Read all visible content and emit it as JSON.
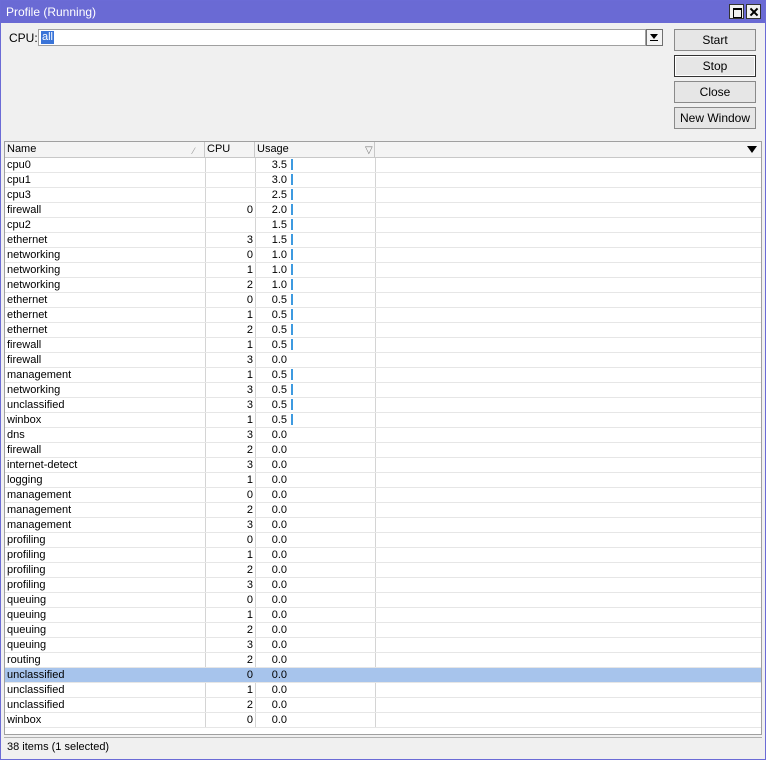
{
  "window": {
    "title": "Profile (Running)"
  },
  "cpu": {
    "label": "CPU:",
    "value": "all"
  },
  "buttons": {
    "start": "Start",
    "stop": "Stop",
    "close": "Close",
    "new_window": "New Window"
  },
  "table": {
    "columns": [
      "Name",
      "CPU",
      "Usage"
    ],
    "rows": [
      {
        "name": "cpu0",
        "cpu": "",
        "usage": "3.5",
        "bar": true
      },
      {
        "name": "cpu1",
        "cpu": "",
        "usage": "3.0",
        "bar": true
      },
      {
        "name": "cpu3",
        "cpu": "",
        "usage": "2.5",
        "bar": true
      },
      {
        "name": "firewall",
        "cpu": "0",
        "usage": "2.0",
        "bar": true
      },
      {
        "name": "cpu2",
        "cpu": "",
        "usage": "1.5",
        "bar": true
      },
      {
        "name": "ethernet",
        "cpu": "3",
        "usage": "1.5",
        "bar": true
      },
      {
        "name": "networking",
        "cpu": "0",
        "usage": "1.0",
        "bar": true
      },
      {
        "name": "networking",
        "cpu": "1",
        "usage": "1.0",
        "bar": true
      },
      {
        "name": "networking",
        "cpu": "2",
        "usage": "1.0",
        "bar": true
      },
      {
        "name": "ethernet",
        "cpu": "0",
        "usage": "0.5",
        "bar": true
      },
      {
        "name": "ethernet",
        "cpu": "1",
        "usage": "0.5",
        "bar": true
      },
      {
        "name": "ethernet",
        "cpu": "2",
        "usage": "0.5",
        "bar": true
      },
      {
        "name": "firewall",
        "cpu": "1",
        "usage": "0.5",
        "bar": true
      },
      {
        "name": "firewall",
        "cpu": "3",
        "usage": "0.0",
        "bar": false
      },
      {
        "name": "management",
        "cpu": "1",
        "usage": "0.5",
        "bar": true
      },
      {
        "name": "networking",
        "cpu": "3",
        "usage": "0.5",
        "bar": true
      },
      {
        "name": "unclassified",
        "cpu": "3",
        "usage": "0.5",
        "bar": true
      },
      {
        "name": "winbox",
        "cpu": "1",
        "usage": "0.5",
        "bar": true
      },
      {
        "name": "dns",
        "cpu": "3",
        "usage": "0.0",
        "bar": false
      },
      {
        "name": "firewall",
        "cpu": "2",
        "usage": "0.0",
        "bar": false
      },
      {
        "name": "internet-detect",
        "cpu": "3",
        "usage": "0.0",
        "bar": false
      },
      {
        "name": "logging",
        "cpu": "1",
        "usage": "0.0",
        "bar": false
      },
      {
        "name": "management",
        "cpu": "0",
        "usage": "0.0",
        "bar": false
      },
      {
        "name": "management",
        "cpu": "2",
        "usage": "0.0",
        "bar": false
      },
      {
        "name": "management",
        "cpu": "3",
        "usage": "0.0",
        "bar": false
      },
      {
        "name": "profiling",
        "cpu": "0",
        "usage": "0.0",
        "bar": false
      },
      {
        "name": "profiling",
        "cpu": "1",
        "usage": "0.0",
        "bar": false
      },
      {
        "name": "profiling",
        "cpu": "2",
        "usage": "0.0",
        "bar": false
      },
      {
        "name": "profiling",
        "cpu": "3",
        "usage": "0.0",
        "bar": false
      },
      {
        "name": "queuing",
        "cpu": "0",
        "usage": "0.0",
        "bar": false
      },
      {
        "name": "queuing",
        "cpu": "1",
        "usage": "0.0",
        "bar": false
      },
      {
        "name": "queuing",
        "cpu": "2",
        "usage": "0.0",
        "bar": false
      },
      {
        "name": "queuing",
        "cpu": "3",
        "usage": "0.0",
        "bar": false
      },
      {
        "name": "routing",
        "cpu": "2",
        "usage": "0.0",
        "bar": false
      },
      {
        "name": "unclassified",
        "cpu": "0",
        "usage": "0.0",
        "bar": false,
        "selected": true
      },
      {
        "name": "unclassified",
        "cpu": "1",
        "usage": "0.0",
        "bar": false
      },
      {
        "name": "unclassified",
        "cpu": "2",
        "usage": "0.0",
        "bar": false
      },
      {
        "name": "winbox",
        "cpu": "0",
        "usage": "0.0",
        "bar": false
      }
    ]
  },
  "status": {
    "text": "38 items (1 selected)"
  },
  "colors": {
    "titlebar": "#6a6ad4",
    "selection": "#a7c4ec",
    "usage_bar": "#3e9ae0"
  },
  "icons": {
    "maximize": "maximize-icon",
    "close": "close-icon",
    "dropdown": "dropdown-icon",
    "sort": "sort-icon",
    "filter": "filter-icon"
  }
}
